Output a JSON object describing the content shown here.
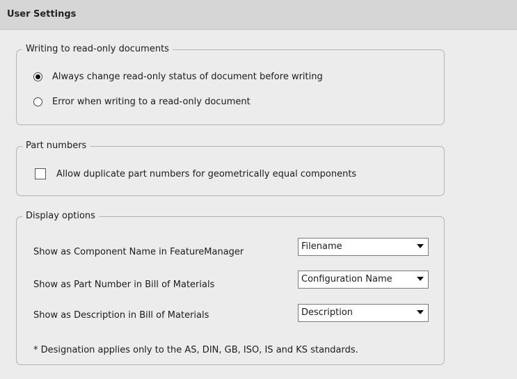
{
  "header": {
    "title": "User Settings"
  },
  "writing_group": {
    "legend": "Writing to read-only documents",
    "options": [
      {
        "label": "Always change read-only status of document before writing",
        "selected": true
      },
      {
        "label": "Error when writing to a read-only document",
        "selected": false
      }
    ]
  },
  "part_numbers_group": {
    "legend": "Part numbers",
    "checkbox": {
      "label": "Allow duplicate part numbers for geometrically equal components",
      "checked": false
    }
  },
  "display_group": {
    "legend": "Display options",
    "rows": [
      {
        "label": "Show as Component Name in FeatureManager",
        "value": "Filename"
      },
      {
        "label": "Show as Part Number in Bill of Materials",
        "value": "Configuration Name"
      },
      {
        "label": "Show as Description in Bill of Materials",
        "value": "Description"
      }
    ],
    "note": "* Designation applies only to the AS, DIN, GB, ISO, IS and KS standards."
  }
}
